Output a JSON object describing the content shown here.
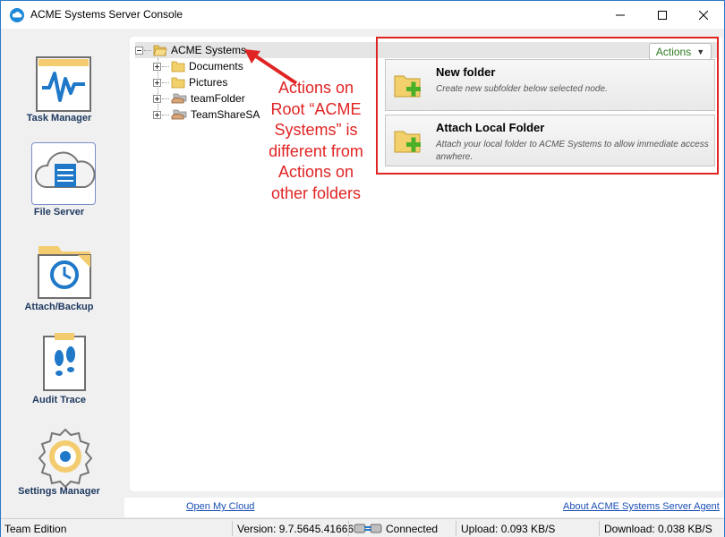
{
  "window": {
    "title": "ACME Systems Server Console"
  },
  "sidebar": {
    "items": [
      {
        "label": "Task Manager",
        "icon": "task-manager-icon"
      },
      {
        "label": "File Server",
        "icon": "file-server-icon",
        "selected": true
      },
      {
        "label": "Attach/Backup",
        "icon": "attach-backup-icon"
      },
      {
        "label": "Audit Trace",
        "icon": "audit-trace-icon"
      },
      {
        "label": "Settings Manager",
        "icon": "settings-manager-icon"
      }
    ]
  },
  "tree": {
    "root": "ACME Systems",
    "children": [
      "Documents",
      "Pictures",
      "teamFolder",
      "TeamShareSA"
    ]
  },
  "annotation": {
    "lines": [
      "Actions on",
      "Root “ACME",
      "Systems” is",
      "different from",
      "Actions on",
      "other folders"
    ]
  },
  "actions": {
    "button_label": "Actions",
    "items": [
      {
        "title": "New folder",
        "description": "Create new subfolder below selected node."
      },
      {
        "title": "Attach Local Folder",
        "description": "Attach your local folder to ACME Systems to allow immediate access anwhere."
      }
    ]
  },
  "links": {
    "open_cloud": "Open My Cloud",
    "about": "About ACME Systems Server Agent"
  },
  "status": {
    "edition": "Team Edition",
    "version": "Version: 9.7.5645.41666",
    "connection": "Connected",
    "upload": "Upload: 0.093 KB/S",
    "download": "Download: 0.038 KB/S"
  },
  "colors": {
    "annotation": "#e02424",
    "link": "#1a4fb5",
    "actions_text": "#2d7a1f",
    "accent": "#2b79c8"
  }
}
